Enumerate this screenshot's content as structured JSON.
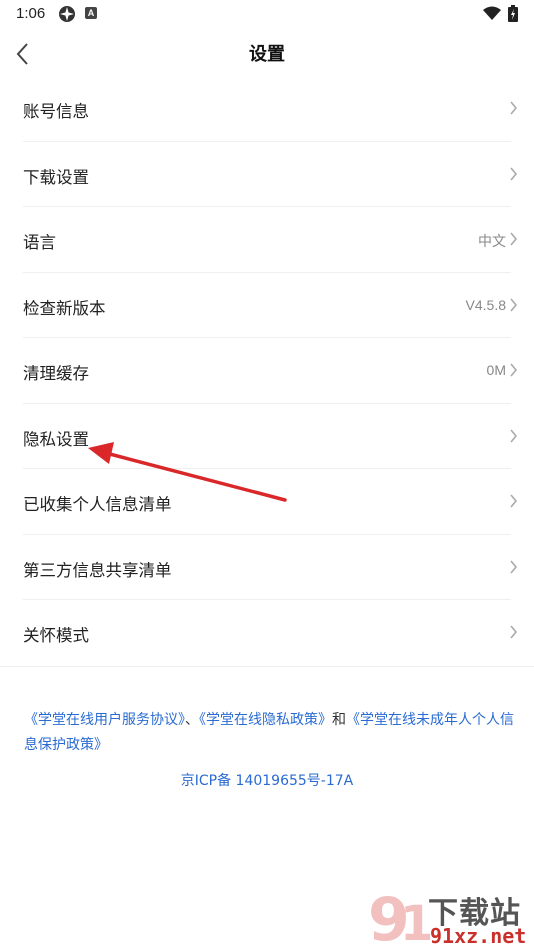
{
  "status_bar": {
    "time": "1:06",
    "icons": [
      "app-notification-icon",
      "a-icon",
      "wifi-icon",
      "battery-icon"
    ]
  },
  "header": {
    "title": "设置",
    "back_icon": "chevron-left-icon"
  },
  "settings": [
    {
      "label": "账号信息",
      "value": ""
    },
    {
      "label": "下载设置",
      "value": ""
    },
    {
      "label": "语言",
      "value": "中文"
    },
    {
      "label": "检查新版本",
      "value": "V4.5.8"
    },
    {
      "label": "清理缓存",
      "value": "0M"
    },
    {
      "label": "隐私设置",
      "value": ""
    },
    {
      "label": "已收集个人信息清单",
      "value": ""
    },
    {
      "label": "第三方信息共享清单",
      "value": ""
    },
    {
      "label": "关怀模式",
      "value": ""
    }
  ],
  "footer": {
    "link1": "《学堂在线用户服务协议》",
    "sep": "、",
    "link2": "《学堂在线隐私政策》",
    "and": "和",
    "link3": "《学堂在线未成年人个人信息保护政策》",
    "icp": "京ICP备 14019655号-17A"
  },
  "watermark": {
    "brand": "下载站",
    "site": "91xz.net"
  },
  "colors": {
    "link": "#2a6bd2",
    "annotation_arrow": "#d9272a"
  }
}
